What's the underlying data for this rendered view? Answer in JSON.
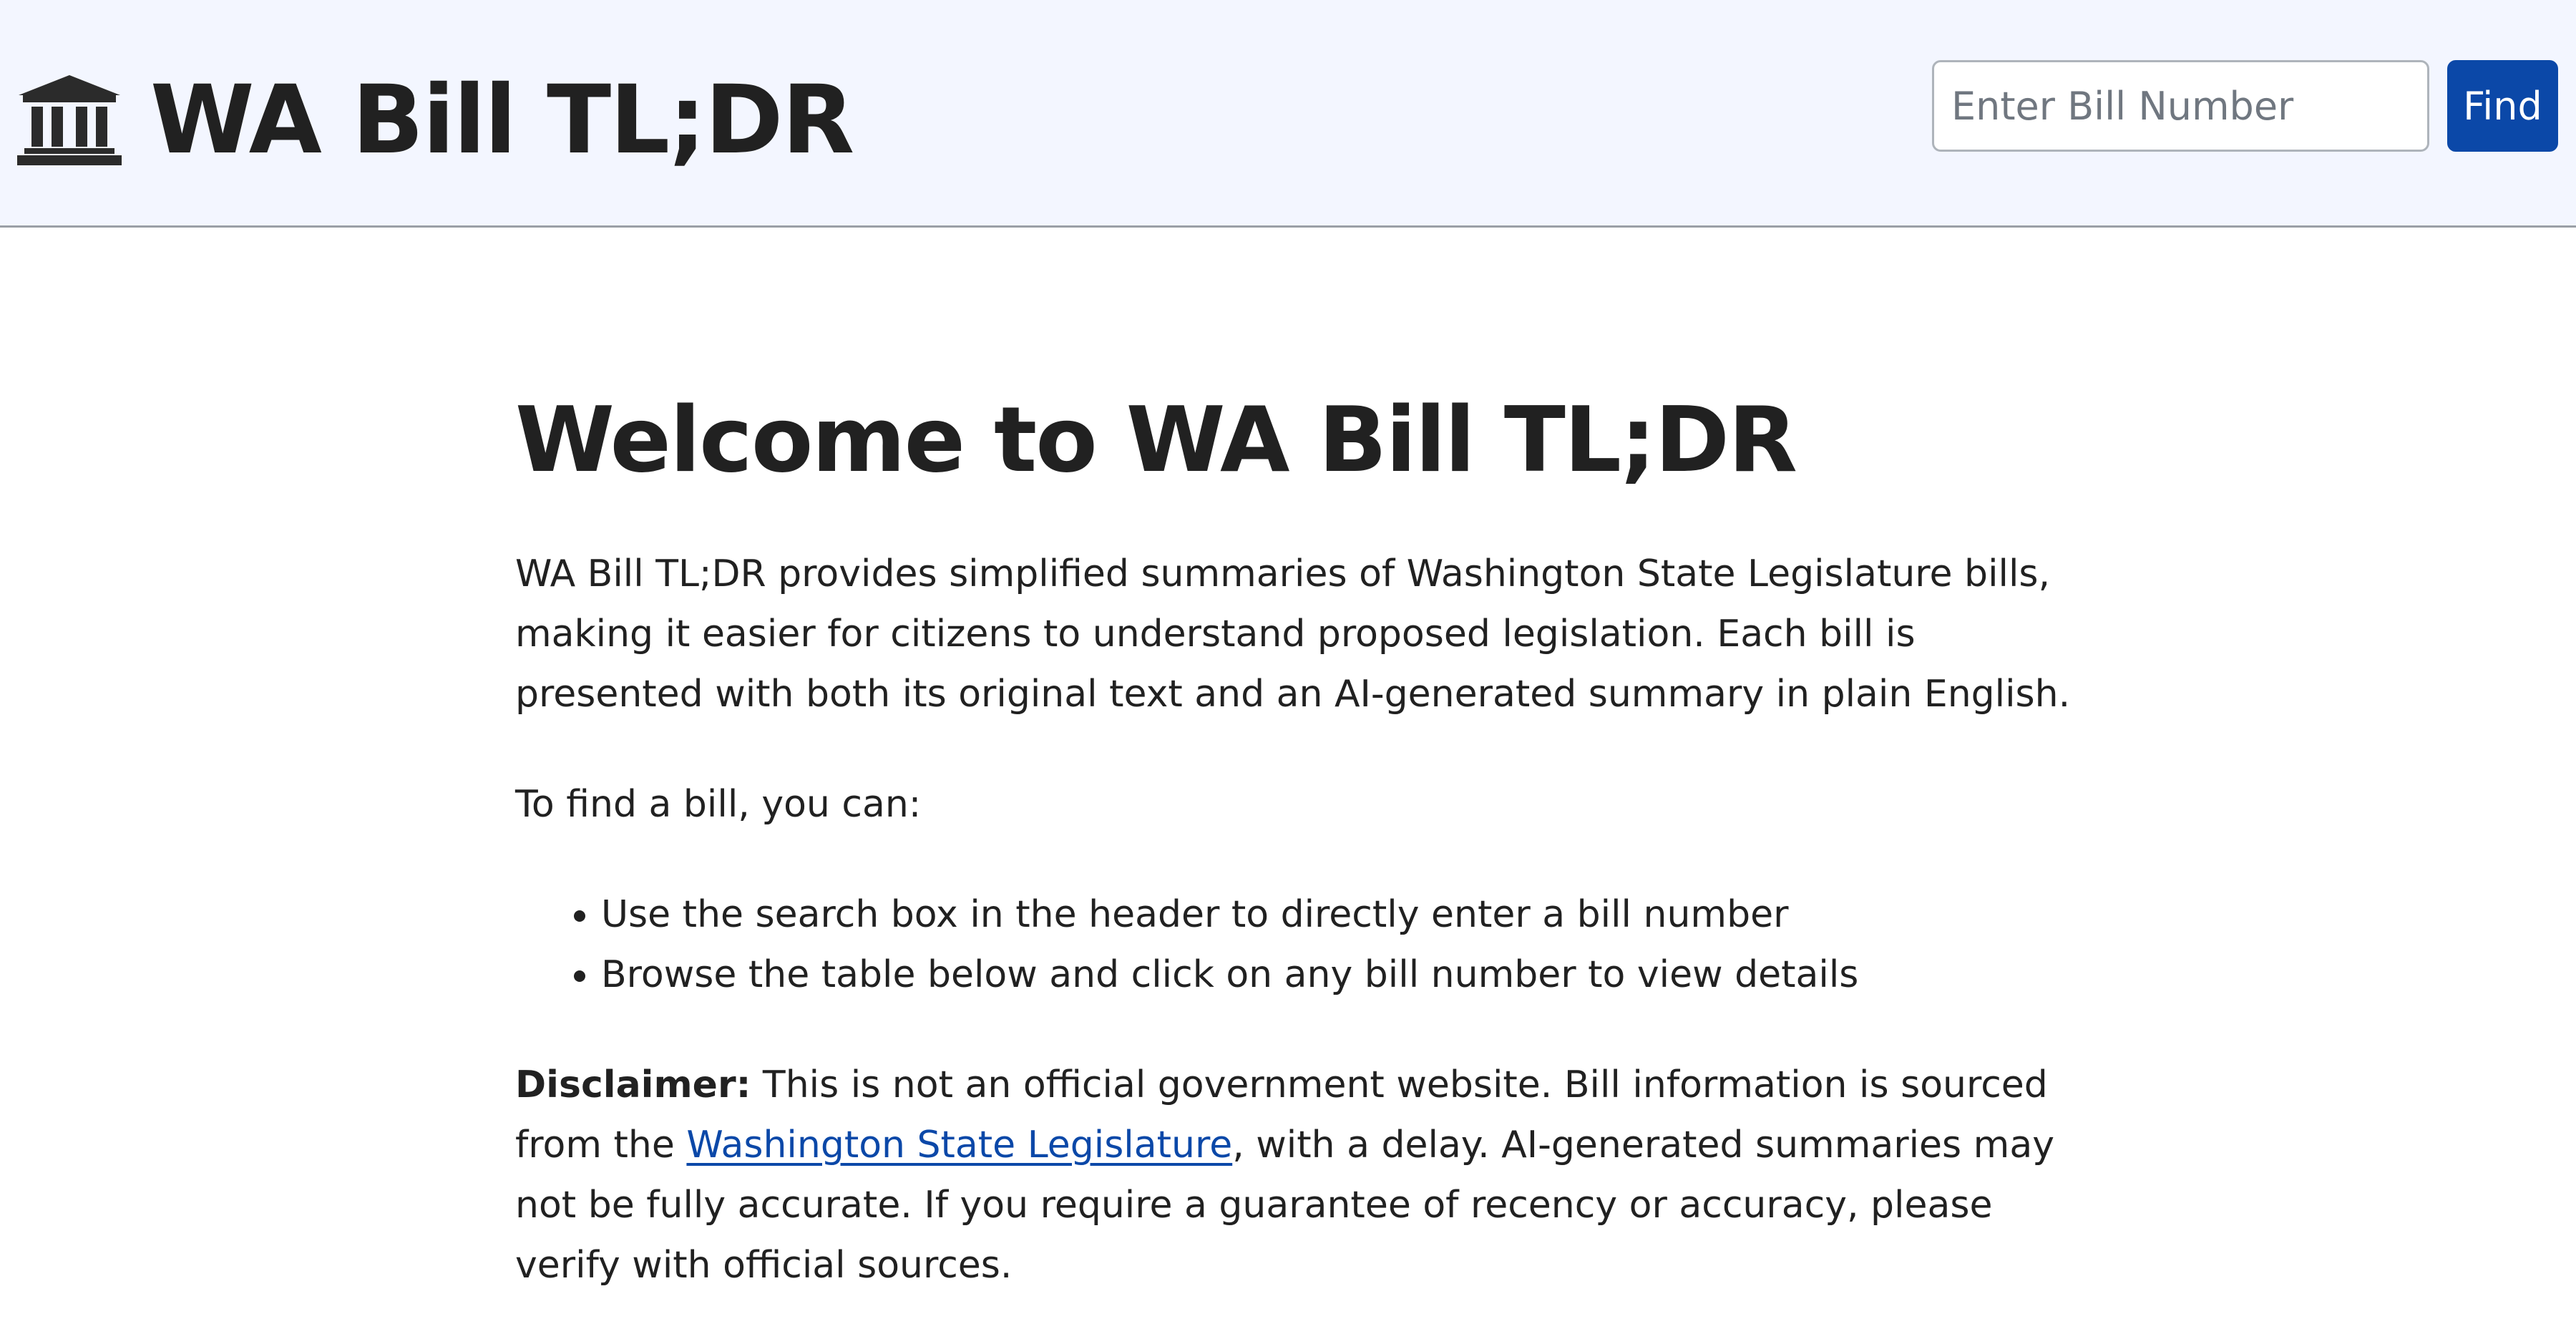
{
  "header": {
    "icon": "government-building-icon",
    "title": "WA Bill TL;DR",
    "search": {
      "placeholder": "Enter Bill Number",
      "value": ""
    },
    "find_label": "Find"
  },
  "main": {
    "title": "Welcome to WA Bill TL;DR",
    "intro": "WA Bill TL;DR provides simplified summaries of Washington State Legislature bills, making it easier for citizens to understand proposed legislation. Each bill is presented with both its original text and an AI-generated summary in plain English.",
    "find_intro": "To find a bill, you can:",
    "options": [
      "Use the search box in the header to directly enter a bill number",
      "Browse the table below and click on any bill number to view details"
    ],
    "disclaimer": {
      "label": "Disclaimer:",
      "text_before_link": " This is not an official government website. Bill information is sourced from the ",
      "link_text": "Washington State Legislature",
      "text_after_link": ", with a delay. AI-generated summaries may not be fully accurate. If you require a guarantee of recency or accuracy, please verify with official sources."
    }
  },
  "colors": {
    "header_background": "#f3f6ff",
    "accent": "#0b48a8",
    "text": "#212121"
  }
}
